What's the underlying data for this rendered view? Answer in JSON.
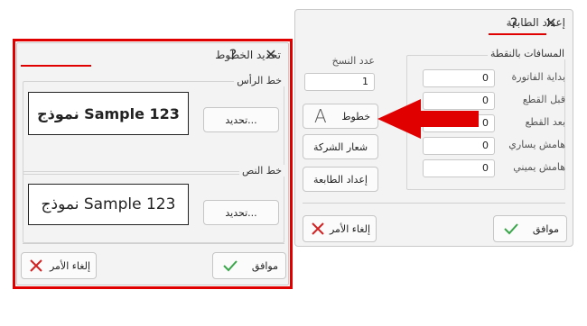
{
  "printer_dialog": {
    "title": "إعداد الطابعة",
    "help": "?",
    "close": "✕",
    "distances_group": "المسافات بالنقطة",
    "fields": [
      {
        "label": "بداية الفاتورة",
        "value": "0"
      },
      {
        "label": "قبل القطع",
        "value": "0"
      },
      {
        "label": "بعد القطع",
        "value": "0"
      },
      {
        "label": "هامش يساري",
        "value": "0"
      },
      {
        "label": "هامش يميني",
        "value": "0"
      }
    ],
    "copies_label": "عدد النسخ",
    "copies_value": "1",
    "fonts_button": "خطوط",
    "fonts_glyph": "A",
    "logo_button": "شعار الشركة",
    "printer_setup_button": "إعداد الطابعة",
    "ok_button": "موافق",
    "cancel_button": "إلغاء الأمر"
  },
  "fonts_dialog": {
    "title": "تحديد الخطوط",
    "help": "?",
    "close": "✕",
    "header_group": "خط الرأس",
    "header_sample": "نموذج Sample 123",
    "header_select_button": "تحديد...",
    "body_group": "خط النص",
    "body_sample": "نموذج Sample 123",
    "body_select_button": "تحديد...",
    "ok_button": "موافق",
    "cancel_button": "إلغاء الأمر"
  },
  "colors": {
    "highlight": "#e00000",
    "ok_check": "#3aa64a",
    "cancel_x": "#d32020"
  }
}
